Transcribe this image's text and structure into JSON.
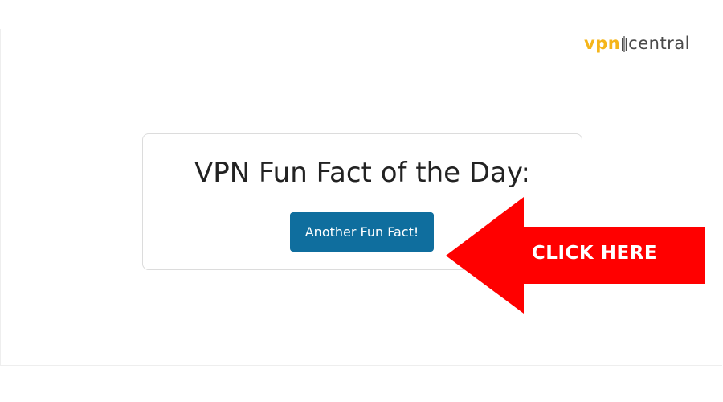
{
  "brand": {
    "logo_vpn": "vpn",
    "logo_central": "central",
    "colors": {
      "vpn": "#f5b51a",
      "central": "#4a4a4a"
    }
  },
  "card": {
    "title": "VPN Fun Fact of the Day:",
    "button_label": "Another Fun Fact!",
    "button_color": "#0f6e9e"
  },
  "callout": {
    "label": "CLICK HERE",
    "color": "#ff0000",
    "icon": "arrow-left-icon"
  }
}
